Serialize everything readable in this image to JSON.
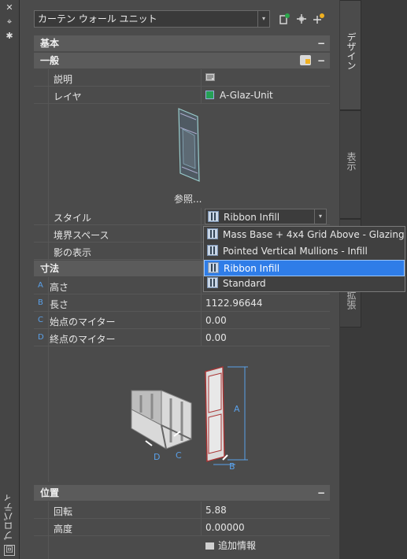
{
  "window": {
    "left_close_glyph": "✕",
    "left_pin_glyph": "⌖",
    "left_settings_glyph": "✱",
    "side_title": "プロパティ",
    "side_small_icon": "回"
  },
  "topbar": {
    "object_type": "カーテン ウォール ユニット",
    "combo_arrow": "▾",
    "icons": [
      "quick-select-icon",
      "select-objects-icon",
      "pick-add-icon"
    ]
  },
  "tabs": [
    {
      "label": "デザイン",
      "state": "active"
    },
    {
      "label": "表示",
      "state": "inactive"
    },
    {
      "label": "拡張",
      "state": "inactive"
    }
  ],
  "sections": {
    "basic": {
      "title": "基本",
      "toggle": "−"
    },
    "general": {
      "title": "一般",
      "toggle": "−"
    },
    "dimensions": {
      "title": "寸法"
    },
    "location": {
      "title": "位置",
      "toggle": "−"
    }
  },
  "general_rows": [
    {
      "label": "説明",
      "value": ""
    },
    {
      "label": "レイヤ",
      "value": "A-Glaz-Unit"
    }
  ],
  "preview_ref_label": "参照...",
  "style_row": {
    "label": "スタイル",
    "value": "Ribbon Infill",
    "arrow": "▾"
  },
  "other_rows": [
    {
      "label": "境界スペース"
    },
    {
      "label": "影の表示"
    }
  ],
  "style_options": [
    {
      "label": "Mass Base + 4x4 Grid Above - Glazing",
      "selected": false
    },
    {
      "label": "Pointed Vertical Mullions - Infill",
      "selected": false
    },
    {
      "label": "Ribbon Infill",
      "selected": true
    },
    {
      "label": "Standard",
      "selected": false
    }
  ],
  "dim_rows": [
    {
      "letter": "A",
      "label": "高さ",
      "value": ""
    },
    {
      "letter": "B",
      "label": "長さ",
      "value": "1122.96644"
    },
    {
      "letter": "C",
      "label": "始点のマイター",
      "value": "0.00"
    },
    {
      "letter": "D",
      "label": "終点のマイター",
      "value": "0.00"
    }
  ],
  "diagram_labels": {
    "A": "A",
    "B": "B",
    "C": "C",
    "D": "D"
  },
  "location_rows": [
    {
      "label": "回転",
      "value": "5.88"
    },
    {
      "label": "高度",
      "value": "0.00000"
    }
  ],
  "extra_info": "追加情報",
  "colors": {
    "layer_swatch": "#25a055",
    "selection": "#2f7de8",
    "dim_letter": "#5aa0e8"
  }
}
